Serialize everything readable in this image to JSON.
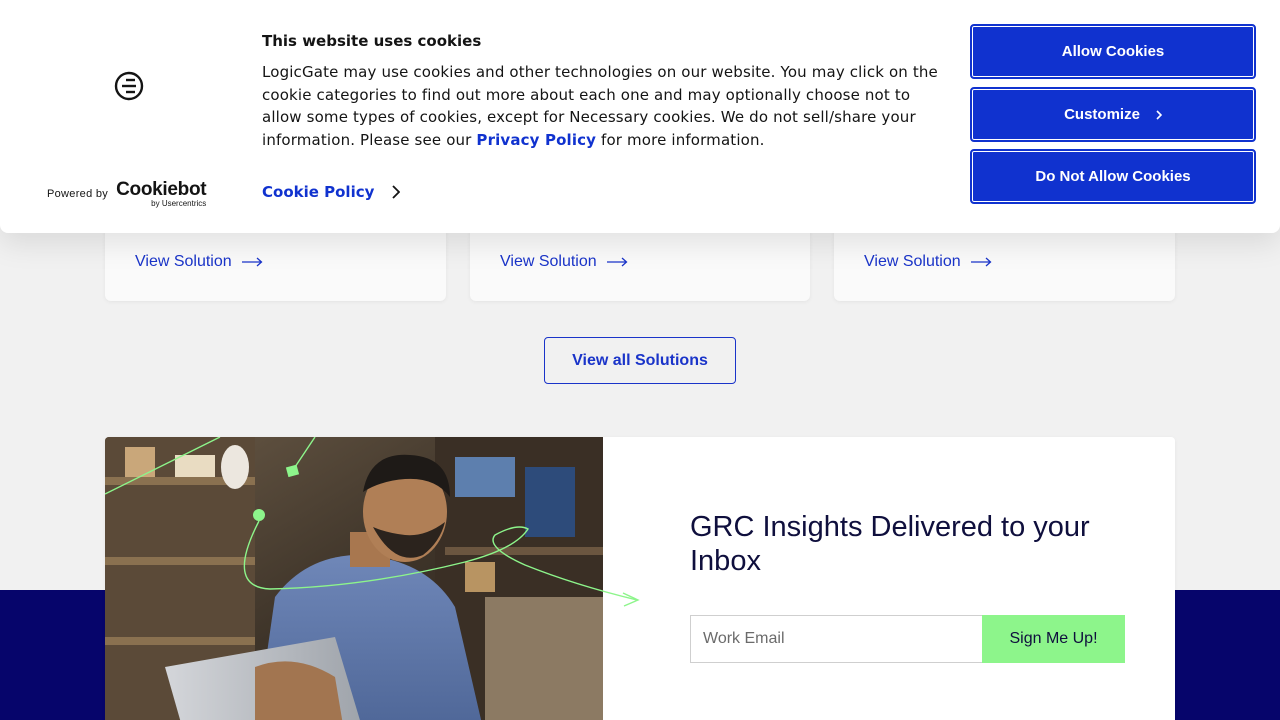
{
  "cookie_banner": {
    "title": "This website uses cookies",
    "body_text": "LogicGate may use cookies and other technologies on our website. You may click on the cookie categories to find out more about each one and may optionally choose not to allow some types of cookies, except for Necessary cookies.  We do not sell/share your information. Please see our ",
    "privacy_link": "Privacy Policy",
    "body_suffix": " for more information.",
    "cookie_policy_link": "Cookie Policy",
    "powered_by": "Powered by",
    "cookiebot_logo": "Cookiebot",
    "cookiebot_sub": "by Usercentrics",
    "buttons": {
      "allow": "Allow Cookies",
      "customize": "Customize",
      "deny": "Do Not Allow Cookies"
    },
    "accent_color": "#1032cf"
  },
  "solutions": {
    "cards": [
      {
        "link_label": "View Solution"
      },
      {
        "link_label": "View Solution"
      },
      {
        "link_label": "View Solution"
      }
    ],
    "view_all_label": "View all Solutions"
  },
  "newsletter": {
    "title": "GRC Insights Delivered to your Inbox",
    "email_placeholder": "Work Email",
    "submit_label": "Sign Me Up!",
    "submit_color": "#8df58b"
  },
  "footer": {
    "band_color": "#06056b"
  }
}
